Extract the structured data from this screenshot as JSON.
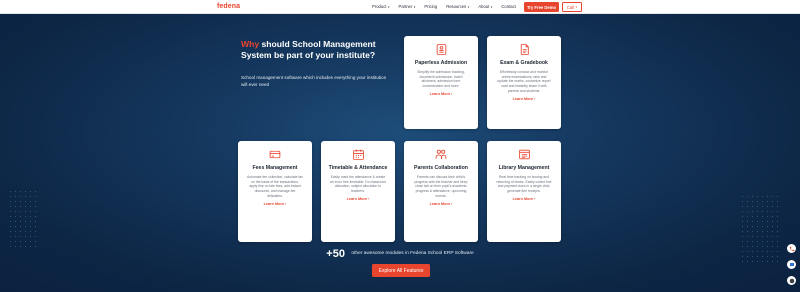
{
  "header": {
    "logo": "fedena",
    "nav": [
      {
        "label": "Product",
        "dropdown": true
      },
      {
        "label": "Partner",
        "dropdown": true
      },
      {
        "label": "Pricing",
        "dropdown": false
      },
      {
        "label": "Resources",
        "dropdown": true
      },
      {
        "label": "About",
        "dropdown": true
      },
      {
        "label": "Contact",
        "dropdown": false
      }
    ],
    "demo_button": "Try Free Demo",
    "call_button": "Call",
    "caret": "▾"
  },
  "hero": {
    "heading_accent": "Why",
    "heading_rest": " should School Management System be part of your institute?",
    "subtext": "School management software which includes everything your institution will ever need"
  },
  "cards": [
    {
      "title": "Paperless Admission",
      "desc": "Simplify the admission tracking, document submission, batch allotment, admission form customization and more.",
      "link": "Learn More ›",
      "icon": "admission-form-icon"
    },
    {
      "title": "Exam & Gradebook",
      "desc": "Effortlessly conduct and monitor online examinations, take and update the marks, customize report card and instantly share it with parents and students.",
      "link": "Learn More ›",
      "icon": "gradebook-icon"
    },
    {
      "title": "Fees Management",
      "desc": "Automate fee collection, calculate tax on the basis of the transactions, apply fine on late fees, add instant discounts, and manage fee defaulters.",
      "link": "Learn More ›",
      "icon": "fees-card-icon"
    },
    {
      "title": "Timetable & Attendance",
      "desc": "Easily mark the attendance & create an error free timetable. Do classroom allocation, subject allocation to teachers.",
      "link": "Learn More ›",
      "icon": "calendar-icon"
    },
    {
      "title": "Parents Collaboration",
      "desc": "Parents can discuss their child's progress with the teacher and keep close tab on their pupil's academic progress & attendance, upcoming events.",
      "link": "Learn More ›",
      "icon": "parents-icon"
    },
    {
      "title": "Library Management",
      "desc": "Real time tracking on issuing and returning of books. Easily collect fine and payment dues in a single click, generate fine receipts.",
      "link": "Learn More ›",
      "icon": "library-icon"
    }
  ],
  "more": {
    "count": "+50",
    "text": "other awesome modules in Fedena School ERP Software"
  },
  "explore_button": "Explore All Features",
  "colors": {
    "accent": "#e8452f",
    "bg": "#0e2a4a"
  }
}
